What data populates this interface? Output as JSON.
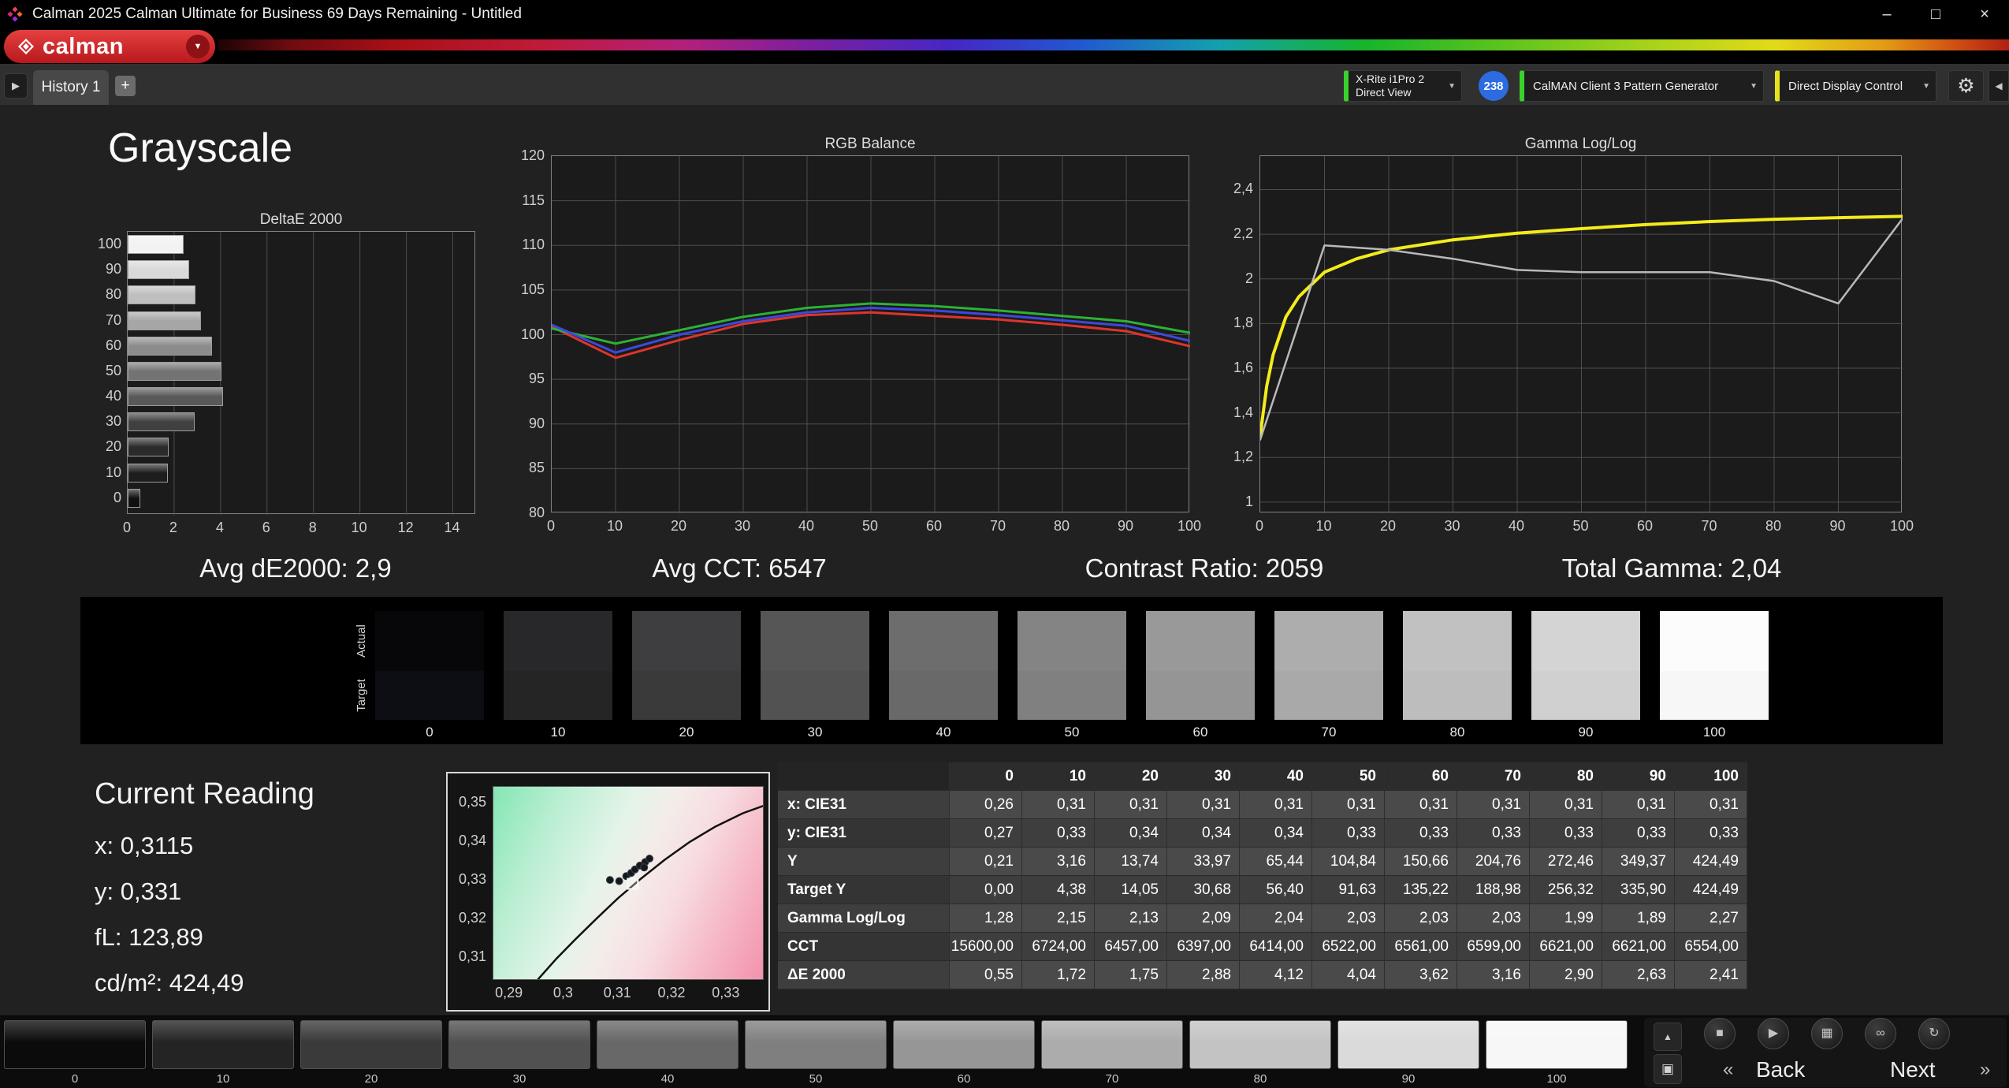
{
  "titlebar": {
    "title": "Calman 2025 Calman Ultimate for Business 69 Days Remaining  - Untitled",
    "window_buttons": {
      "minimize": "–",
      "maximize": "□",
      "close": "×"
    }
  },
  "brand": {
    "name": "calman",
    "dropdown_arrow": "▼",
    "red": "#cf2027"
  },
  "tabbar": {
    "left_scroll": "▶",
    "history_tab": "History 1",
    "add_tab": "+",
    "meter": {
      "line1": "X-Rite i1Pro 2",
      "line2": "Direct View"
    },
    "meter_badge": "238",
    "pattern_generator": "CalMAN Client 3 Pattern Generator",
    "display_control": "Direct Display Control",
    "gear": "⚙",
    "collapse": "◀",
    "dropdown_arrow": "▼",
    "accents": {
      "meter_green": "#3ad12c",
      "pattern_green": "#3ad12c",
      "display_yellow": "#e6e21e",
      "badge_blue": "#2d6ce0"
    }
  },
  "page": {
    "title": "Grayscale"
  },
  "stats": {
    "avg_de": "Avg dE2000: 2,9",
    "avg_cct": "Avg CCT: 6547",
    "contrast": "Contrast Ratio: 2059",
    "total_gamma": "Total Gamma: 2,04"
  },
  "chart_data": [
    {
      "id": "deltae",
      "type": "bar",
      "orientation": "horizontal",
      "title": "DeltaE 2000",
      "categories": [
        "100",
        "90",
        "80",
        "70",
        "60",
        "50",
        "40",
        "30",
        "20",
        "10",
        "0"
      ],
      "values": [
        2.41,
        2.63,
        2.9,
        3.16,
        3.62,
        4.04,
        4.12,
        2.88,
        1.75,
        1.72,
        0.55
      ],
      "bar_colors": [
        "#f2f2f2",
        "#d9d9d9",
        "#bfbfbf",
        "#a6a6a6",
        "#8c8c8c",
        "#737373",
        "#595959",
        "#404040",
        "#2b2b2b",
        "#1d1d1d",
        "#101010"
      ],
      "xlim": [
        0,
        15
      ],
      "x_ticks": [
        0,
        2,
        4,
        6,
        8,
        10,
        12,
        14
      ],
      "grid": true
    },
    {
      "id": "rgb",
      "type": "line",
      "title": "RGB Balance",
      "x": [
        0,
        10,
        20,
        30,
        40,
        50,
        60,
        70,
        80,
        90,
        100
      ],
      "series": [
        {
          "name": "Red",
          "color": "#de352c",
          "stroke_width": 3,
          "values": [
            100.9,
            97.4,
            99.4,
            101.2,
            102.2,
            102.5,
            102.1,
            101.7,
            101.1,
            100.4,
            98.7
          ]
        },
        {
          "name": "Green",
          "color": "#2eb135",
          "stroke_width": 3,
          "values": [
            100.7,
            99.0,
            100.5,
            102.0,
            103.0,
            103.5,
            103.2,
            102.7,
            102.1,
            101.5,
            100.2
          ]
        },
        {
          "name": "Blue",
          "color": "#3c49dd",
          "stroke_width": 3,
          "values": [
            101.1,
            98.0,
            100.0,
            101.5,
            102.5,
            103.0,
            102.7,
            102.2,
            101.6,
            101.0,
            99.3
          ]
        }
      ],
      "ylim": [
        80,
        120
      ],
      "y_ticks": [
        120,
        115,
        110,
        105,
        100,
        95,
        90,
        85,
        80
      ],
      "y_tick_labels": [
        "120",
        "115",
        "110",
        "105",
        "100",
        "95",
        "90",
        "85",
        "80"
      ],
      "x_ticks": [
        0,
        10,
        20,
        30,
        40,
        50,
        60,
        70,
        80,
        90,
        100
      ],
      "grid": true
    },
    {
      "id": "gamma",
      "type": "line",
      "title": "Gamma Log/Log",
      "x": [
        0,
        10,
        20,
        30,
        40,
        50,
        60,
        70,
        80,
        90,
        100
      ],
      "series": [
        {
          "name": "Target Gamma",
          "color": "#f3eb1c",
          "stroke_width": 4,
          "x": [
            0,
            1,
            2,
            4,
            6,
            10,
            15,
            20,
            30,
            40,
            50,
            60,
            70,
            80,
            90,
            100
          ],
          "values": [
            1.3,
            1.52,
            1.66,
            1.83,
            1.92,
            2.03,
            2.09,
            2.13,
            2.175,
            2.205,
            2.225,
            2.243,
            2.257,
            2.267,
            2.274,
            2.28
          ]
        },
        {
          "name": "Measured Gamma",
          "color": "#b9b9b9",
          "stroke_width": 2.5,
          "values": [
            1.28,
            2.15,
            2.13,
            2.09,
            2.04,
            2.03,
            2.03,
            2.03,
            1.99,
            1.89,
            2.27
          ]
        }
      ],
      "ylim": [
        0.95,
        2.55
      ],
      "y_ticks": [
        2.4,
        2.2,
        2.0,
        1.8,
        1.6,
        1.4,
        1.2,
        1.0
      ],
      "y_tick_labels": [
        "2,4",
        "2,2",
        "2",
        "1,8",
        "1,6",
        "1,4",
        "1,2",
        "1"
      ],
      "x_ticks": [
        0,
        10,
        20,
        30,
        40,
        50,
        60,
        70,
        80,
        90,
        100
      ],
      "grid": true
    },
    {
      "id": "cie",
      "type": "scatter",
      "title": "CIE xy chromaticity (zoom)",
      "xlim": [
        0.287,
        0.337
      ],
      "ylim": [
        0.304,
        0.354
      ],
      "x_ticks": [
        0.29,
        0.3,
        0.31,
        0.32,
        0.33
      ],
      "x_tick_labels": [
        "0,29",
        "0,3",
        "0,31",
        "0,32",
        "0,33"
      ],
      "y_ticks": [
        0.35,
        0.34,
        0.33,
        0.32,
        0.31
      ],
      "y_tick_labels": [
        "0,35",
        "0,34",
        "0,33",
        "0,32",
        "0,31"
      ],
      "points": [
        [
          0.3085,
          0.33
        ],
        [
          0.3102,
          0.3297
        ],
        [
          0.3115,
          0.331
        ],
        [
          0.3124,
          0.3318
        ],
        [
          0.3131,
          0.3327
        ],
        [
          0.314,
          0.3337
        ],
        [
          0.315,
          0.3346
        ],
        [
          0.3158,
          0.3355
        ],
        [
          0.3148,
          0.3332
        ]
      ],
      "target_point": [
        0.3127,
        0.329
      ],
      "locus": [
        [
          0.295,
          0.304
        ],
        [
          0.2985,
          0.3095
        ],
        [
          0.3022,
          0.3148
        ],
        [
          0.306,
          0.32
        ],
        [
          0.31,
          0.3253
        ],
        [
          0.3142,
          0.3303
        ],
        [
          0.3186,
          0.3352
        ],
        [
          0.3232,
          0.3398
        ],
        [
          0.328,
          0.3438
        ],
        [
          0.333,
          0.3472
        ],
        [
          0.337,
          0.3492
        ]
      ]
    }
  ],
  "grayscale_strip": {
    "side_labels": [
      "Actual",
      "Target"
    ],
    "levels": [
      "0",
      "10",
      "20",
      "30",
      "40",
      "50",
      "60",
      "70",
      "80",
      "90",
      "100"
    ],
    "actual_colors": [
      "#07070a",
      "#28282a",
      "#3e3e40",
      "#565656",
      "#6d6d6d",
      "#848484",
      "#999999",
      "#adadad",
      "#c1c1c1",
      "#d4d4d4",
      "#fcfcfc"
    ],
    "target_colors": [
      "#0c0e14",
      "#252525",
      "#3a3a3a",
      "#525252",
      "#696969",
      "#808080",
      "#959595",
      "#a9a9a9",
      "#bdbdbd",
      "#d0d0d0",
      "#f7f7f7"
    ]
  },
  "current_reading": {
    "title": "Current Reading",
    "x": "x: 0,3115",
    "y": "y: 0,331",
    "fl": "fL: 123,89",
    "cdm2": "cd/m²: 424,49"
  },
  "table": {
    "columns": [
      "0",
      "10",
      "20",
      "30",
      "40",
      "50",
      "60",
      "70",
      "80",
      "90",
      "100"
    ],
    "rows": [
      {
        "label": "x: CIE31",
        "values": [
          "0,26",
          "0,31",
          "0,31",
          "0,31",
          "0,31",
          "0,31",
          "0,31",
          "0,31",
          "0,31",
          "0,31",
          "0,31"
        ]
      },
      {
        "label": "y: CIE31",
        "values": [
          "0,27",
          "0,33",
          "0,34",
          "0,34",
          "0,34",
          "0,33",
          "0,33",
          "0,33",
          "0,33",
          "0,33",
          "0,33"
        ]
      },
      {
        "label": "Y",
        "values": [
          "0,21",
          "3,16",
          "13,74",
          "33,97",
          "65,44",
          "104,84",
          "150,66",
          "204,76",
          "272,46",
          "349,37",
          "424,49"
        ]
      },
      {
        "label": "Target Y",
        "values": [
          "0,00",
          "4,38",
          "14,05",
          "30,68",
          "56,40",
          "91,63",
          "135,22",
          "188,98",
          "256,32",
          "335,90",
          "424,49"
        ]
      },
      {
        "label": "Gamma Log/Log",
        "values": [
          "1,28",
          "2,15",
          "2,13",
          "2,09",
          "2,04",
          "2,03",
          "2,03",
          "2,03",
          "1,99",
          "1,89",
          "2,27"
        ]
      },
      {
        "label": "CCT",
        "values": [
          "15600,00",
          "6724,00",
          "6457,00",
          "6397,00",
          "6414,00",
          "6522,00",
          "6561,00",
          "6599,00",
          "6621,00",
          "6621,00",
          "6554,00"
        ]
      },
      {
        "label": "ΔE 2000",
        "values": [
          "0,55",
          "1,72",
          "1,75",
          "2,88",
          "4,12",
          "4,04",
          "3,62",
          "3,16",
          "2,90",
          "2,63",
          "2,41"
        ]
      }
    ]
  },
  "bottom_bar": {
    "levels": [
      "0",
      "10",
      "20",
      "30",
      "40",
      "50",
      "60",
      "70",
      "80",
      "90",
      "100"
    ],
    "level_colors": [
      "#0b0b0b",
      "#242424",
      "#3a3a3a",
      "#515151",
      "#686868",
      "#7f7f7f",
      "#969696",
      "#acacac",
      "#c3c3c3",
      "#dadada",
      "#f7f7f7"
    ],
    "panel_up": "▲",
    "panel_square": "▣",
    "transport_icons": [
      {
        "name": "stop",
        "glyph": "■"
      },
      {
        "name": "play",
        "glyph": "▶"
      },
      {
        "name": "save",
        "glyph": "▦"
      },
      {
        "name": "link",
        "glyph": "∞"
      },
      {
        "name": "refresh",
        "glyph": "↻"
      }
    ],
    "nav": {
      "back_chevron": "«",
      "back": "Back",
      "next": "Next",
      "next_chevron": "»"
    }
  }
}
